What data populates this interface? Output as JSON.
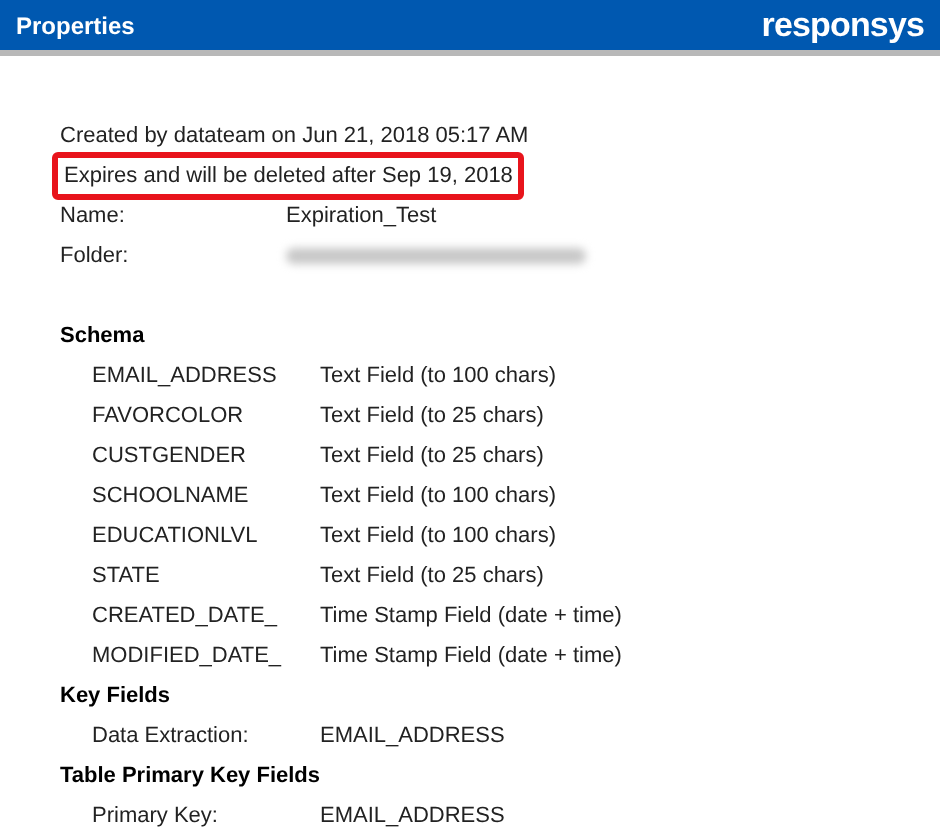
{
  "header": {
    "title": "Properties",
    "logo": "responsys"
  },
  "created": "Created by datateam on Jun 21, 2018 05:17 AM",
  "expiry": {
    "text": "Expires and will be deleted after Sep 19, 2018",
    "highlighted": true
  },
  "details": [
    {
      "label": "Name:",
      "value": "Expiration_Test",
      "blurred": false
    },
    {
      "label": "Folder:",
      "blurred": true
    }
  ],
  "sections": [
    {
      "title": "Schema",
      "rows": [
        {
          "name": "EMAIL_ADDRESS",
          "value": "Text Field (to 100 chars)"
        },
        {
          "name": "FAVORCOLOR",
          "value": "Text Field (to 25 chars)"
        },
        {
          "name": "CUSTGENDER",
          "value": "Text Field (to 25 chars)"
        },
        {
          "name": "SCHOOLNAME",
          "value": "Text Field (to 100 chars)"
        },
        {
          "name": "EDUCATIONLVL",
          "value": "Text Field (to 100 chars)"
        },
        {
          "name": "STATE",
          "value": "Text Field (to 25 chars)"
        },
        {
          "name": "CREATED_DATE_",
          "value": "Time Stamp Field (date + time)"
        },
        {
          "name": "MODIFIED_DATE_",
          "value": "Time Stamp Field (date + time)"
        }
      ]
    },
    {
      "title": "Key Fields",
      "rows": [
        {
          "name": "Data Extraction:",
          "value": "EMAIL_ADDRESS"
        }
      ]
    },
    {
      "title": "Table Primary Key Fields",
      "rows": [
        {
          "name": "Primary Key:",
          "value": "EMAIL_ADDRESS"
        }
      ]
    }
  ]
}
